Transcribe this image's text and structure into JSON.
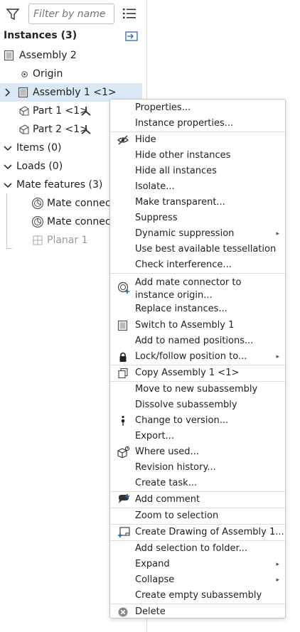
{
  "toolbar": {
    "filter_placeholder": "Filter by name"
  },
  "instances_header": "Instances (3)",
  "tree": {
    "assembly2": "Assembly 2",
    "origin": "Origin",
    "assembly1": "Assembly 1 <1>",
    "part1": "Part 1 <1>",
    "part2": "Part 2 <1>",
    "items": "Items (0)",
    "loads": "Loads (0)",
    "mate_features": "Mate features (3)",
    "mate_connector_1": "Mate connector",
    "mate_connector_2": "Mate connector",
    "planar1": "Planar 1"
  },
  "menu": {
    "properties": "Properties...",
    "instance_properties": "Instance properties...",
    "hide": "Hide",
    "hide_other": "Hide other instances",
    "hide_all": "Hide all instances",
    "isolate": "Isolate...",
    "make_transparent": "Make transparent...",
    "suppress": "Suppress",
    "dynamic_suppression": "Dynamic suppression",
    "use_best": "Use best available tessellation",
    "check_interference": "Check interference...",
    "add_mate_connector": "Add mate connector to instance origin...",
    "replace_instances": "Replace instances...",
    "switch_to": "Switch to Assembly 1",
    "add_named_positions": "Add to named positions...",
    "lock_follow": "Lock/follow position to...",
    "copy": "Copy Assembly 1 <1>",
    "move_new_sub": "Move to new subassembly",
    "dissolve_sub": "Dissolve subassembly",
    "change_version": "Change to version...",
    "export": "Export...",
    "where_used": "Where used...",
    "revision_history": "Revision history...",
    "create_task": "Create task...",
    "add_comment": "Add comment",
    "zoom_selection": "Zoom to selection",
    "create_drawing": "Create Drawing of Assembly 1...",
    "add_to_folder": "Add selection to folder...",
    "expand": "Expand",
    "collapse": "Collapse",
    "create_empty_sub": "Create empty subassembly",
    "delete": "Delete",
    "submenu_arrow": "▸"
  }
}
